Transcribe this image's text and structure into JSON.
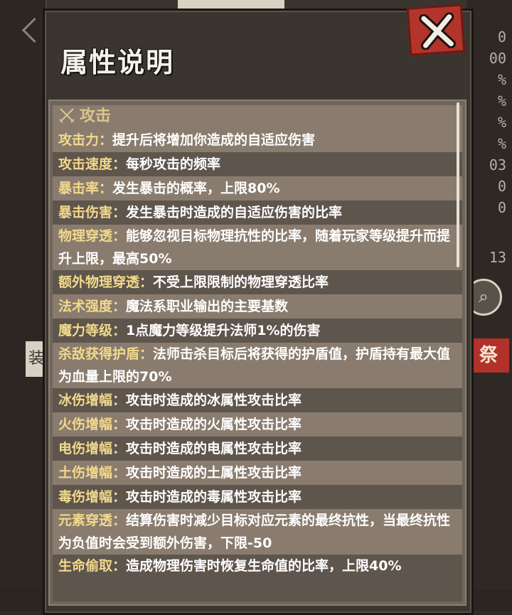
{
  "dialog": {
    "title": "属性说明",
    "close_icon": "close-x-icon",
    "section_header": "攻击",
    "section_icon": "crossed-swords-icon",
    "accent_color": "#f2d98c",
    "close_color": "#b3342b"
  },
  "attributes": [
    {
      "label": "攻击力：",
      "desc": "提升后将增加你造成的自适应伤害"
    },
    {
      "label": "攻击速度：",
      "desc": "每秒攻击的频率"
    },
    {
      "label": "暴击率：",
      "desc": "发生暴击的概率，上限80%"
    },
    {
      "label": "暴击伤害：",
      "desc": "发生暴击时造成的自适应伤害的比率"
    },
    {
      "label": "物理穿透：",
      "desc": "能够忽视目标物理抗性的比率，随着玩家等级提升而提升上限，最高50%"
    },
    {
      "label": "额外物理穿透：",
      "desc": "不受上限限制的物理穿透比率"
    },
    {
      "label": "法术强度：",
      "desc": "魔法系职业输出的主要基数"
    },
    {
      "label": "魔力等级：",
      "desc": "1点魔力等级提升法师1%的伤害"
    },
    {
      "label": "杀敌获得护盾：",
      "desc": "法师击杀目标后将获得的护盾值，护盾持有最大值为血量上限的70%"
    },
    {
      "label": "冰伤增幅：",
      "desc": "攻击时造成的冰属性攻击比率"
    },
    {
      "label": "火伤增幅：",
      "desc": "攻击时造成的火属性攻击比率"
    },
    {
      "label": "电伤增幅：",
      "desc": "攻击时造成的电属性攻击比率"
    },
    {
      "label": "土伤增幅：",
      "desc": "攻击时造成的土属性攻击比率"
    },
    {
      "label": "毒伤增幅：",
      "desc": "攻击时造成的毒属性攻击比率"
    },
    {
      "label": "元素穿透：",
      "desc": "结算伤害时减少目标对应元素的最终抗性，当最终抗性为负值时会受到额外伤害，下限-50"
    },
    {
      "label": "生命偷取：",
      "desc": "造成物理伤害时恢复生命值的比率，上限40%"
    }
  ],
  "background": {
    "right_values": [
      "0",
      "00",
      "%",
      "%",
      "%",
      "%",
      "03",
      "0",
      "0",
      "13"
    ],
    "right_search_icon": "search-icon",
    "right_tag": "祭",
    "left_tag": "装"
  }
}
